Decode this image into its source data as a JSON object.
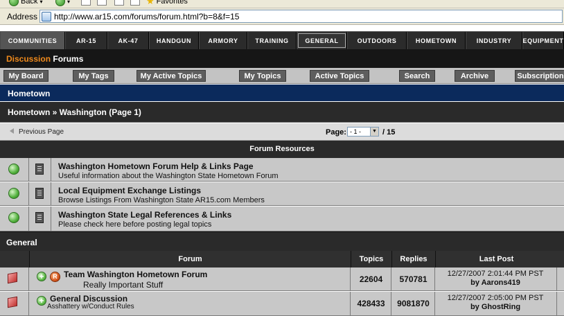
{
  "browser": {
    "toolbar": {
      "back_label": "Back",
      "favorites_label": "Favorites"
    },
    "address": {
      "label": "Address",
      "url": "http://www.ar15.com/forums/forum.html?b=8&f=15"
    }
  },
  "topnav": {
    "tabs": [
      "COMMUNITIES",
      "AR-15",
      "AK-47",
      "HANDGUN",
      "ARMORY",
      "TRAINING",
      "GENERAL",
      "OUTDOORS",
      "HOMETOWN",
      "INDUSTRY",
      "EQUIPMENT"
    ],
    "active_tab": "GENERAL"
  },
  "subnav": {
    "discussion": "Discussion",
    "forums": " Forums"
  },
  "buttons": [
    "My Board",
    "My Tags",
    "My Active Topics",
    "My Topics",
    "Active Topics",
    "Search",
    "Archive",
    "Subscriptions"
  ],
  "section_title": "Hometown",
  "breadcrumb": "Hometown » Washington (Page 1)",
  "pagination": {
    "previous_label": "Previous Page",
    "page_label": "Page:",
    "selected": "- 1 -",
    "total": "/ 15"
  },
  "resources": {
    "heading": "Forum Resources",
    "items": [
      {
        "title": "Washington Hometown Forum Help & Links Page",
        "desc": "Useful information about the Washington State Hometown Forum"
      },
      {
        "title": "Local Equipment Exchange Listings",
        "desc": "Browse Listings From Washington State AR15.com Members"
      },
      {
        "title": "Washington State Legal References & Links",
        "desc": "Please check here before posting legal topics"
      }
    ]
  },
  "general": {
    "heading": "General",
    "columns": {
      "forum": "Forum",
      "topics": "Topics",
      "replies": "Replies",
      "last_post": "Last Post"
    },
    "rows": [
      {
        "title": "Team Washington Hometown Forum",
        "subtitle": "Really Important Stuff",
        "topics": "22604",
        "replies": "570781",
        "last_date": "12/27/2007 2:01:44 PM PST",
        "last_by": "by Aarons419",
        "badge": "R"
      },
      {
        "title": "General Discussion",
        "subtitle": "Asshattery w/Conduct Rules",
        "topics": "428433",
        "replies": "9081870",
        "last_date": "12/27/2007 2:05:00 PM PST",
        "last_by": "by GhostRing"
      }
    ]
  }
}
